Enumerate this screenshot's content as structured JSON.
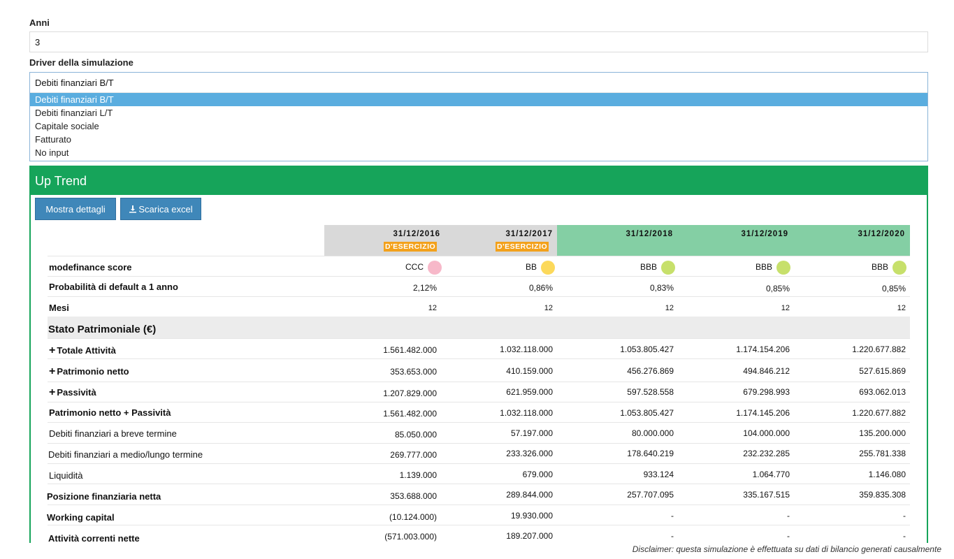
{
  "form": {
    "anni_label": "Anni",
    "anni_value": "3",
    "driver_label": "Driver della simulazione",
    "driver_value": "Debiti finanziari B/T",
    "options": [
      "Debiti finanziari B/T",
      "Debiti finanziari L/T",
      "Capitale sociale",
      "Fatturato",
      "No input"
    ],
    "selected_option": "Debiti finanziari B/T"
  },
  "panel": {
    "title": "Up Trend",
    "btn_dettagli": "Mostra dettagli",
    "btn_excel": "Scarica excel",
    "icon_download": "download-icon",
    "colors": {
      "header": "#16a45a",
      "historical_header": "#d9d9d9",
      "projected_header": "#84cfa4",
      "badge": "#f3a11b",
      "button": "#3f87b9"
    }
  },
  "columns": [
    {
      "date": "31/12/2016",
      "badge": "D'ESERCIZIO"
    },
    {
      "date": "31/12/2017",
      "badge": "D'ESERCIZIO"
    },
    {
      "date": "31/12/2018",
      "badge": ""
    },
    {
      "date": "31/12/2019",
      "badge": ""
    },
    {
      "date": "31/12/2020",
      "badge": ""
    }
  ],
  "score": {
    "label": "modefinance score",
    "values": [
      "CCC",
      "BB",
      "BBB",
      "BBB",
      "BBB"
    ],
    "colors": [
      "#f7b8c9",
      "#fcd95b",
      "#c7e06b",
      "#c7e06b",
      "#c7e06b"
    ]
  },
  "rows": [
    {
      "label": "Probabilità di default a 1 anno",
      "values": [
        "2,12%",
        "0,86%",
        "0,83%",
        "0,85%",
        "0,85%"
      ]
    },
    {
      "label": "Mesi",
      "values": [
        "12",
        "12",
        "12",
        "12",
        "12"
      ]
    }
  ],
  "section_title": "Stato Patrimoniale (€)",
  "sp_rows": [
    {
      "label": "Totale Attività",
      "values": [
        "1.561.482.000",
        "1.032.118.000",
        "1.053.805.427",
        "1.174.154.206",
        "1.220.677.882"
      ]
    },
    {
      "label": "Patrimonio netto",
      "values": [
        "353.653.000",
        "410.159.000",
        "456.276.869",
        "494.846.212",
        "527.615.869"
      ]
    },
    {
      "label": "Passività",
      "values": [
        "1.207.829.000",
        "621.959.000",
        "597.528.558",
        "679.298.993",
        "693.062.013"
      ]
    },
    {
      "label": "Patrimonio netto + Passività",
      "values": [
        "1.561.482.000",
        "1.032.118.000",
        "1.053.805.427",
        "1.174.145.206",
        "1.220.677.882"
      ]
    },
    {
      "label": "Debiti finanziari a breve termine",
      "values": [
        "85.050.000",
        "57.197.000",
        "80.000.000",
        "104.000.000",
        "135.200.000"
      ]
    },
    {
      "label": "Debiti finanziari a medio/lungo termine",
      "values": [
        "269.777.000",
        "233.326.000",
        "178.640.219",
        "232.232.285",
        "255.781.338"
      ]
    },
    {
      "label": "Liquidità",
      "values": [
        "1.139.000",
        "679.000",
        "933.124",
        "1.064.770",
        "1.146.080"
      ]
    },
    {
      "label": "Posizione finanziaria netta",
      "values": [
        "353.688.000",
        "289.844.000",
        "257.707.095",
        "335.167.515",
        "359.835.308"
      ]
    },
    {
      "label": "Working capital",
      "values": [
        "(10.124.000)",
        "19.930.000",
        "-",
        "-",
        "-"
      ]
    },
    {
      "label": "Attività correnti nette",
      "values": [
        "(571.003.000)",
        "189.207.000",
        "-",
        "-",
        "-"
      ]
    }
  ],
  "disclaimer": "Disclaimer: questa simulazione è effettuata su dati di bilancio generati causalmente"
}
